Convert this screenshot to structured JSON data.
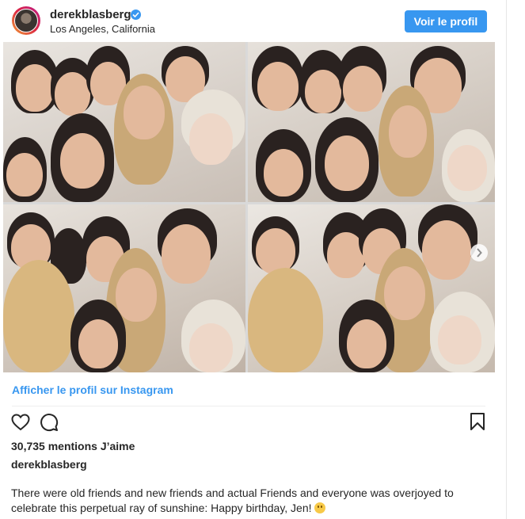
{
  "post": {
    "username": "derekblasberg",
    "location": "Los Angeles, California",
    "view_profile_button": "Voir le profil",
    "verified_icon": "verified-badge-icon",
    "view_on_instagram_link": "Afficher le profil sur Instagram",
    "likes_text": "30,735 mentions J’aime",
    "caption_username": "derekblasberg",
    "caption_text": "There were old friends and new friends and actual Friends and everyone was overjoyed to celebrate this perpetual ray of sunshine: Happy birthday, Jen!",
    "caption_emoji": "smiling-face-emoji"
  },
  "icons": {
    "like": "heart-icon",
    "comment": "comment-icon",
    "save": "bookmark-icon",
    "next": "chevron-right-icon"
  },
  "colors": {
    "accent": "#3897f0",
    "text": "#262626",
    "divider": "#efefef"
  }
}
